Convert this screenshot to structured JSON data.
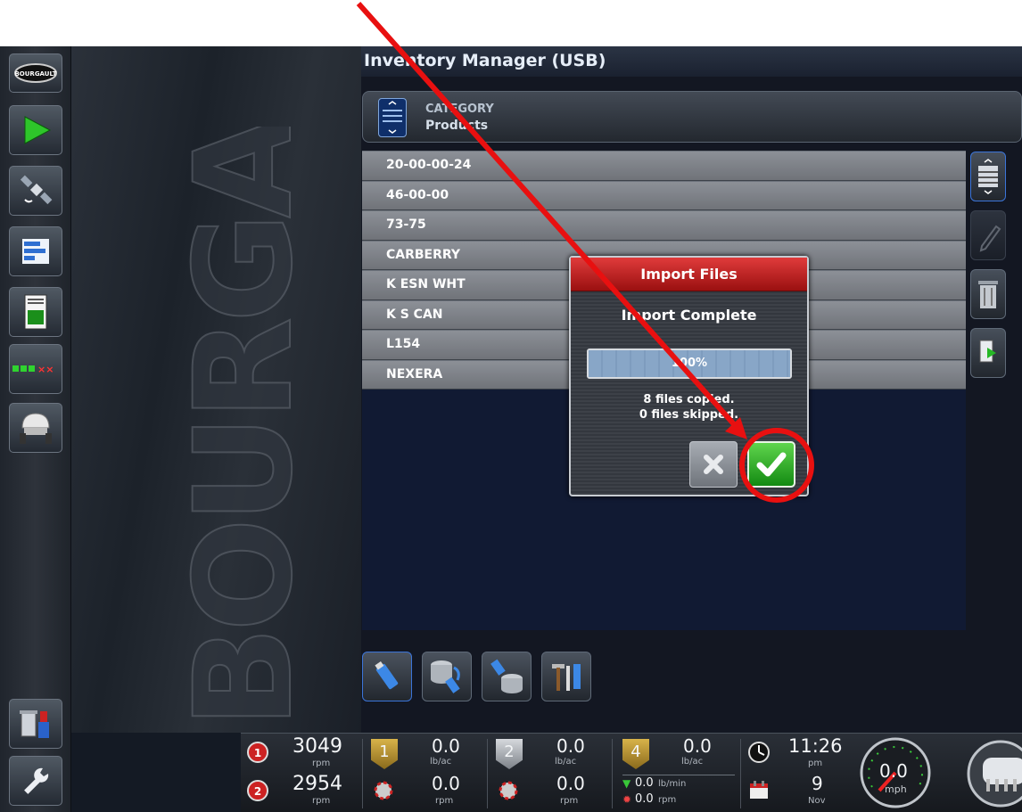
{
  "panel": {
    "title": "Inventory Manager (USB)"
  },
  "category": {
    "label": "CATEGORY",
    "value": "Products"
  },
  "products": [
    "20-00-00-24",
    "46-00-00",
    "73-75",
    "CARBERRY",
    "K ESN WHT",
    "K S CAN",
    "L154",
    "NEXERA"
  ],
  "dialog": {
    "title": "Import Files",
    "status": "Import Complete",
    "progress_percent": 100,
    "progress_label": "100%",
    "copied": "8 files copied.",
    "skipped": "0 files skipped."
  },
  "sidebar": {
    "logo": "BOURGAULT",
    "items": [
      "guidance-arrow-icon",
      "satellite-icon",
      "bars-icon",
      "document-icon",
      "sections-icon",
      "seeder-icon",
      "usb-trash-icon",
      "wrench-icon"
    ]
  },
  "status": {
    "fan1_rpm": "3049",
    "fan1_unit": "rpm",
    "fan2_rpm": "2954",
    "fan2_unit": "rpm",
    "tank1_rate": "0.0",
    "tank1_unit": "lb/ac",
    "tank1_label": "1",
    "tank1_meter": "0.0",
    "tank1_meter_unit": "rpm",
    "tank2_rate": "0.0",
    "tank2_unit": "lb/ac",
    "tank2_label": "2",
    "tank2_meter": "0.0",
    "tank2_meter_unit": "rpm",
    "tank4_rate": "0.0",
    "tank4_unit": "lb/ac",
    "tank4_label": "4",
    "tank4_flow": "0.0",
    "tank4_flow_unit": "lb/min",
    "tank4_meter": "0.0",
    "tank4_meter_unit": "rpm",
    "time": "11:26",
    "ampm": "pm",
    "day": "9",
    "month": "Nov",
    "speed": "0.0",
    "speed_unit": "mph"
  },
  "colors": {
    "accent_red": "#e01010",
    "dialog_title": "#c42020",
    "ok_green": "#2eb02a",
    "progress": "#88a6c7"
  }
}
